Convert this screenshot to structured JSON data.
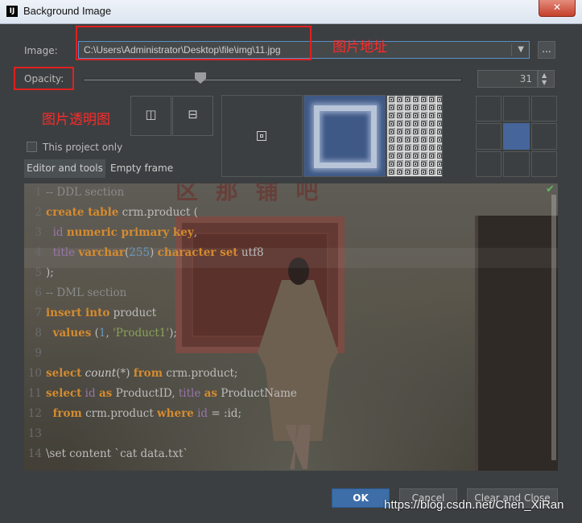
{
  "window": {
    "title": "Background Image",
    "close_glyph": "✕"
  },
  "form": {
    "image_label": "Image:",
    "image_path": "C:\\Users\\Administrator\\Desktop\\file\\img\\11.jpg",
    "browse_label": "...",
    "opacity_label": "Opacity:",
    "opacity_value": "31",
    "opacity_fraction": 0.31,
    "this_project_only": "This project only",
    "editor_and_tools": "Editor and tools",
    "empty_frame": "Empty frame"
  },
  "icons": {
    "flip_horizontal": "flip-horizontal-icon",
    "flip_vertical": "flip-vertical-icon",
    "combo_arrow": "chevron-down-icon",
    "spin_up": "▲",
    "spin_down": "▼",
    "checkmark": "✔"
  },
  "glyphs": {
    "flip_h": "◫",
    "flip_v": "⊟",
    "combo_arrow": "▼"
  },
  "fill_modes": [
    "plain",
    "scale",
    "tile"
  ],
  "selected_anchor": 4,
  "preview_sign": "区 那 铺 吧",
  "code_lines": [
    {
      "n": "1",
      "html": "<span class=\"cm\">-- DDL section</span>"
    },
    {
      "n": "2",
      "html": "<span class=\"kw\">create table</span> crm.product ("
    },
    {
      "n": "3",
      "html": "  <span class=\"id\">id</span> <span class=\"kw\">numeric primary key</span>,"
    },
    {
      "n": "4",
      "html": "  <span class=\"id\">title</span> <span class=\"kw\">varchar</span>(<span class=\"nm\">255</span>) <span class=\"kw\">character set</span> utf8"
    },
    {
      "n": "5",
      "html": ");"
    },
    {
      "n": "6",
      "html": "<span class=\"cm\">-- DML section</span>"
    },
    {
      "n": "7",
      "html": "<span class=\"kw\">insert into</span> product"
    },
    {
      "n": "8",
      "html": "  <span class=\"kw\">values</span> (<span class=\"nm\">1</span>, <span class=\"st\">'Product1'</span>);"
    },
    {
      "n": "9",
      "html": ""
    },
    {
      "n": "10",
      "html": "<span class=\"kw\">select</span> <span class=\"fn\">count</span>(*) <span class=\"kw\">from</span> crm.product;"
    },
    {
      "n": "11",
      "html": "<span class=\"kw\">select</span> <span class=\"id\">id</span> <span class=\"kw\">as</span> ProductID, <span class=\"id\">title</span> <span class=\"kw\">as</span> ProductName"
    },
    {
      "n": "12",
      "html": "  <span class=\"kw\">from</span> crm.product <span class=\"kw\">where</span> <span class=\"id\">id</span> = :id;"
    },
    {
      "n": "13",
      "html": ""
    },
    {
      "n": "14",
      "html": "\\set content `cat data.txt`"
    }
  ],
  "buttons": {
    "ok": "OK",
    "cancel": "Cancel",
    "clear_and_close": "Clear and Close"
  },
  "annotations": {
    "image_address": "图片地址",
    "image_opacity": "图片透明图"
  },
  "watermark": "https://blog.csdn.net/Chen_XiRan",
  "colors": {
    "accent": "#3d6ea8",
    "annotation": "#e02020",
    "selected_anchor": "#46659a"
  }
}
